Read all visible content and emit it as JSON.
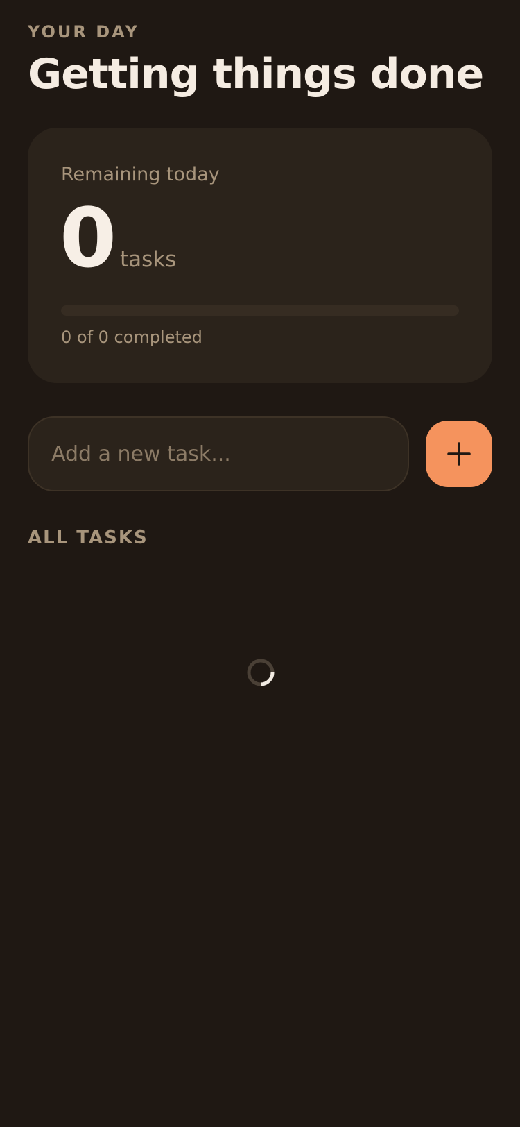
{
  "header": {
    "eyebrow": "YOUR DAY",
    "title": "Getting things done"
  },
  "summary": {
    "label": "Remaining today",
    "count": "0",
    "unit": "tasks",
    "progress_fraction": 0,
    "progress_text": "0 of 0 completed"
  },
  "new_task": {
    "placeholder": "Add a new task...",
    "value": "",
    "add_icon": "plus-icon"
  },
  "tasks_section": {
    "title": "ALL TASKS",
    "status_icon": "loading-spinner-icon"
  },
  "colors": {
    "background": "#1f1813",
    "card": "#2b231b",
    "accent": "#f5935d",
    "text_primary": "#f5ece2",
    "text_muted": "#a8957c"
  }
}
